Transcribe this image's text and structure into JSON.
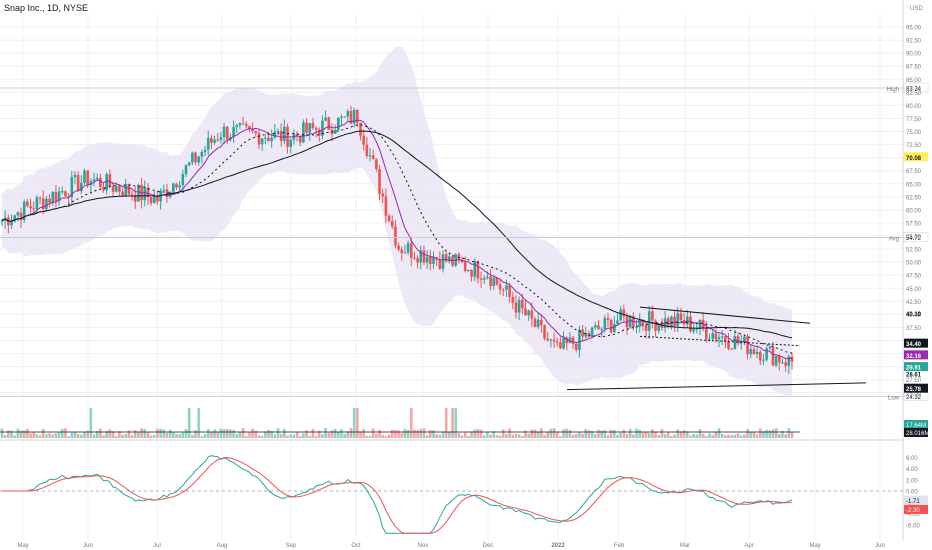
{
  "header": {
    "title": "Snap Inc., 1D, NYSE"
  },
  "currency": "USD",
  "colors": {
    "up": "#26a69a",
    "down": "#ef5350",
    "ema_fast": "#9c27b0",
    "sma_slow": "#131722",
    "band_fill": "#e8e4f5",
    "grid": "#eef0f3",
    "axis_text": "#787b86",
    "tag_high": "#ffffff",
    "tag_avg": "#ffffff",
    "tag_low": "#ffffff",
    "tag_yellow": "#ffee58",
    "tag_black": "#131722",
    "tag_purple": "#9c27b0",
    "tag_green": "#26a69a",
    "macd_line": "#26a69a",
    "signal_line": "#ef5350"
  },
  "chart_data": [
    {
      "type": "candlestick",
      "title": "Snap Inc., 1D, NYSE",
      "x_labels": [
        "May",
        "Jun",
        "Jul",
        "Aug",
        "Sep",
        "Oct",
        "Nov",
        "Dec",
        "2022",
        "Feb",
        "Mar",
        "Apr",
        "May",
        "Jun"
      ],
      "ylim": [
        24,
        97.5
      ],
      "y_ticks": [
        95,
        92.5,
        90,
        87.5,
        85,
        82.5,
        80,
        77.5,
        75,
        72.5,
        70,
        67.5,
        65,
        62.5,
        60,
        57.5,
        55,
        52.5,
        50,
        47.5,
        45,
        42.5,
        40,
        37.5,
        35,
        32.5,
        30,
        27.5,
        25
      ],
      "y_tick_labels": [
        "95.00",
        "92.50",
        "90.00",
        "87.50",
        "85.00",
        "82.50",
        "80.00",
        "77.50",
        "75.00",
        "72.50",
        "70.00",
        "67.50",
        "65.00",
        "62.50",
        "60.00",
        "57.50",
        "55.00",
        "52.50",
        "50.00",
        "47.50",
        "45.00",
        "42.50",
        "40.00",
        "37.50",
        "35.00",
        "32.50",
        "30.00",
        "27.50",
        "25.00"
      ],
      "close_monthly": {
        "x": [
          "May",
          "Jun",
          "Jul",
          "Aug",
          "Sep",
          "Oct",
          "Nov",
          "Dec",
          "2022",
          "Feb",
          "Mar",
          "Apr"
        ],
        "close": [
          58.0,
          66.0,
          62.0,
          75.0,
          74.0,
          78.0,
          53.0,
          48.0,
          33.0,
          39.0,
          38.5,
          31.0
        ]
      },
      "horizontal_levels": [
        {
          "name": "High",
          "value": 83.34,
          "label": "83.34"
        },
        {
          "name": "Avg",
          "value": 54.72,
          "label": "54.72"
        },
        {
          "name": "Low",
          "value": 24.32,
          "label": "24.32"
        }
      ],
      "price_tags": [
        {
          "value": 70.08,
          "label": "70.08",
          "style": "yellow"
        },
        {
          "value": 40.19,
          "label": "40.19",
          "style": "none"
        },
        {
          "value": 34.4,
          "label": "34.40",
          "style": "black"
        },
        {
          "value": 32.16,
          "label": "32.16",
          "style": "purple"
        },
        {
          "value": 29.91,
          "label": "29.91",
          "style": "green"
        },
        {
          "value": 28.61,
          "label": "28.61",
          "style": "none"
        },
        {
          "value": 25.78,
          "label": "25.78",
          "style": "black"
        }
      ]
    },
    {
      "type": "bar",
      "title": "Volume",
      "labels": [
        "17.64M",
        "28.016M"
      ]
    },
    {
      "type": "line",
      "title": "MACD",
      "ylim": [
        -8,
        8
      ],
      "y_ticks": [
        6,
        4,
        2,
        0,
        -2,
        -4,
        -6
      ],
      "y_tick_labels": [
        "6.00",
        "4.00",
        "2.00",
        "0.00",
        "-2.00",
        "-4.00",
        "-6.00"
      ],
      "labels": [
        "-1.71",
        "-2.30"
      ]
    }
  ]
}
